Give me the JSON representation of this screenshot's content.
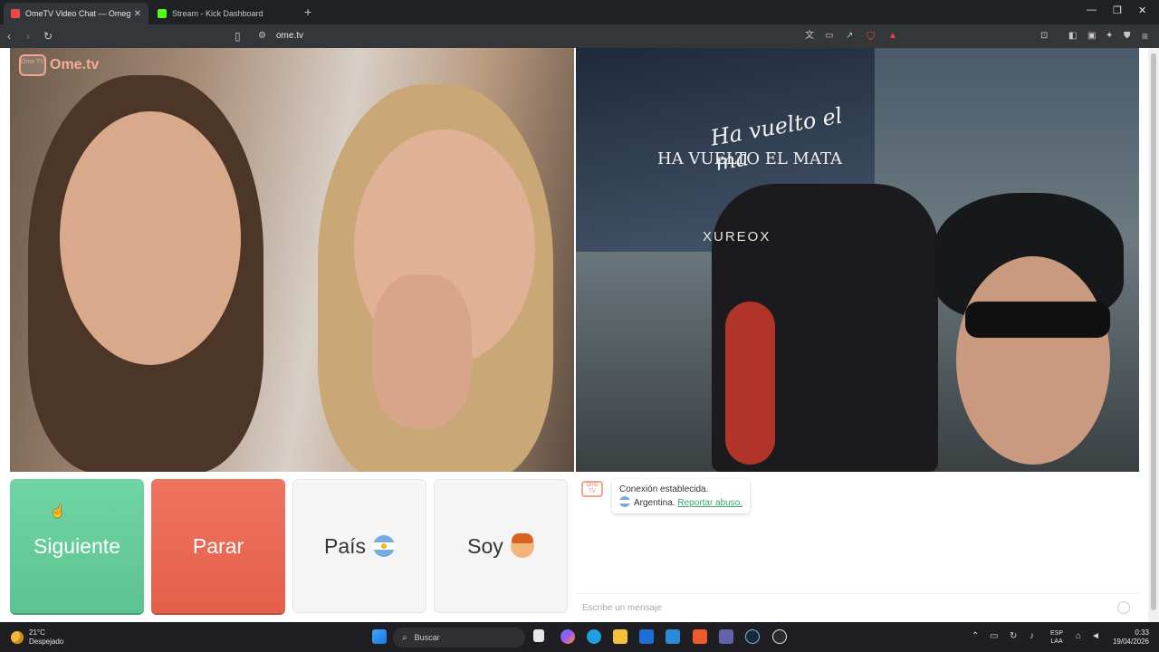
{
  "browser": {
    "tabs": [
      {
        "title": "OmeTV Video Chat — Omegl",
        "active": true,
        "favicon_color": "#e84a4a"
      },
      {
        "title": "Stream - Kick Dashboard",
        "active": false,
        "favicon_color": "#53fc18"
      }
    ],
    "url": "ome.tv"
  },
  "site": {
    "logo_text": "Ome.tv",
    "logo_badge": "Ome TV",
    "buttons": {
      "next": "Siguiente",
      "stop": "Parar",
      "country": "País",
      "me": "Soy"
    },
    "tv_overlay": {
      "line1": "Ha vuelto el ma",
      "line2": "HA VUELTO EL MATA"
    },
    "chair_brand": "XUREOX",
    "colors": {
      "next_button": "#6fd5a4",
      "stop_button": "#ee7460",
      "link": "#3aa673"
    }
  },
  "chat": {
    "message_line1": "Conexión establecida.",
    "country": "Argentina.",
    "report_link": "Reportar abuso.",
    "input_placeholder": "Escribe un mensaje"
  },
  "taskbar": {
    "weather_temp": "21°C",
    "weather_desc": "Despejado",
    "search_label": "Buscar",
    "lang_line1": "ESP",
    "lang_line2": "LAA",
    "time": "0:33",
    "date": "19/04/2026"
  }
}
